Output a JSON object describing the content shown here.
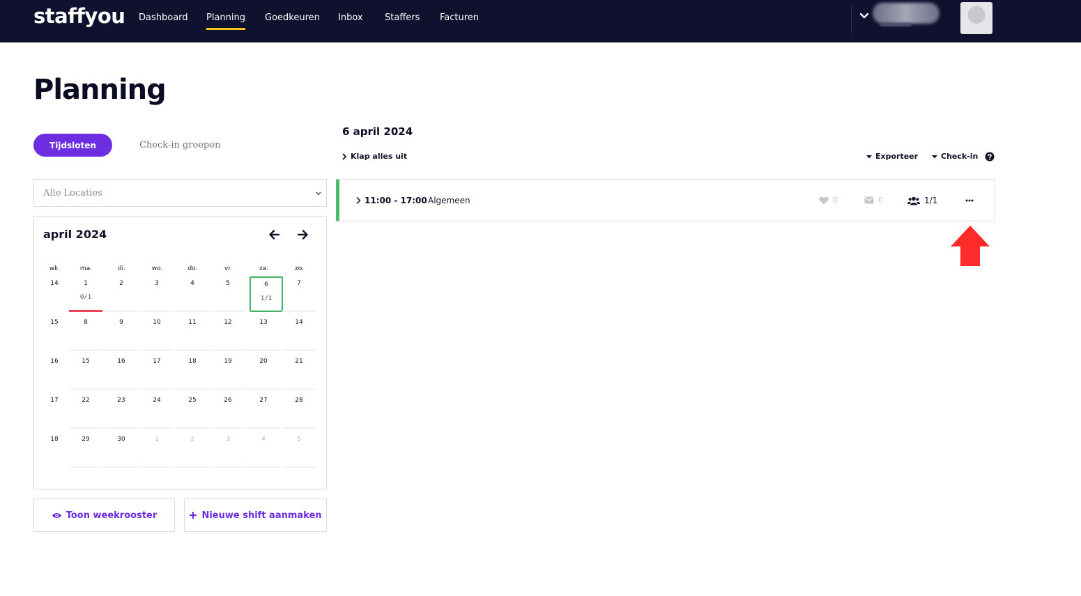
{
  "app": {
    "logo": "staffyou"
  },
  "nav": {
    "items": [
      {
        "label": "Dashboard",
        "active": false
      },
      {
        "label": "Planning",
        "active": true
      },
      {
        "label": "Goedkeuren",
        "active": false
      },
      {
        "label": "Inbox",
        "active": false
      },
      {
        "label": "Staffers",
        "active": false
      },
      {
        "label": "Facturen",
        "active": false
      }
    ],
    "active_color": "#ffc21a"
  },
  "page": {
    "title": "Planning"
  },
  "tabs": {
    "items": [
      {
        "label": "Tijdsloten",
        "active": true
      },
      {
        "label": "Check-in groepen",
        "active": false
      }
    ]
  },
  "location_select": {
    "value": "Alle Locaties"
  },
  "calendar": {
    "month_label": "april 2024",
    "weekday_headers": [
      "wk",
      "ma.",
      "di.",
      "wo.",
      "do.",
      "vr.",
      "za.",
      "zo."
    ],
    "weeks": [
      {
        "wk": "14",
        "days": [
          {
            "d": "1",
            "count": "0/1",
            "underred": true
          },
          {
            "d": "2"
          },
          {
            "d": "3"
          },
          {
            "d": "4"
          },
          {
            "d": "5"
          },
          {
            "d": "6",
            "count": "1/1",
            "selected": true
          },
          {
            "d": "7"
          }
        ]
      },
      {
        "wk": "15",
        "days": [
          {
            "d": "8"
          },
          {
            "d": "9"
          },
          {
            "d": "10"
          },
          {
            "d": "11"
          },
          {
            "d": "12"
          },
          {
            "d": "13"
          },
          {
            "d": "14"
          }
        ]
      },
      {
        "wk": "16",
        "days": [
          {
            "d": "15"
          },
          {
            "d": "16"
          },
          {
            "d": "17"
          },
          {
            "d": "18"
          },
          {
            "d": "19"
          },
          {
            "d": "20"
          },
          {
            "d": "21"
          }
        ]
      },
      {
        "wk": "17",
        "days": [
          {
            "d": "22"
          },
          {
            "d": "23"
          },
          {
            "d": "24"
          },
          {
            "d": "25"
          },
          {
            "d": "26"
          },
          {
            "d": "27"
          },
          {
            "d": "28"
          }
        ]
      },
      {
        "wk": "18",
        "days": [
          {
            "d": "29"
          },
          {
            "d": "30"
          },
          {
            "d": "1",
            "muted": true
          },
          {
            "d": "2",
            "muted": true
          },
          {
            "d": "3",
            "muted": true
          },
          {
            "d": "4",
            "muted": true
          },
          {
            "d": "5",
            "muted": true
          }
        ]
      }
    ],
    "selected_color": "#45b36b",
    "alert_color": "#e8435a"
  },
  "buttons": {
    "week_view": "Toon weekrooster",
    "new_shift": "Nieuwe shift aanmaken"
  },
  "day_panel": {
    "title": "6 april 2024",
    "collapse_all": "Klap alles uit",
    "export": "Exporteer",
    "checkin": "Check-in"
  },
  "shift": {
    "time": "11:00 - 17:00",
    "location": "Algemeen",
    "likes": "0",
    "messages": "0",
    "staff": "1/1",
    "accent_color": "#4fb86f"
  },
  "colors": {
    "primary": "#6c2ee0",
    "topbar": "#10112f",
    "annotation_arrow": "#ff2a2a"
  },
  "icons": {
    "eye": "eye-icon",
    "plus": "plus-icon",
    "heart": "heart-icon",
    "envelope": "envelope-icon",
    "users": "users-icon",
    "more": "more-icon",
    "help": "help-icon"
  }
}
